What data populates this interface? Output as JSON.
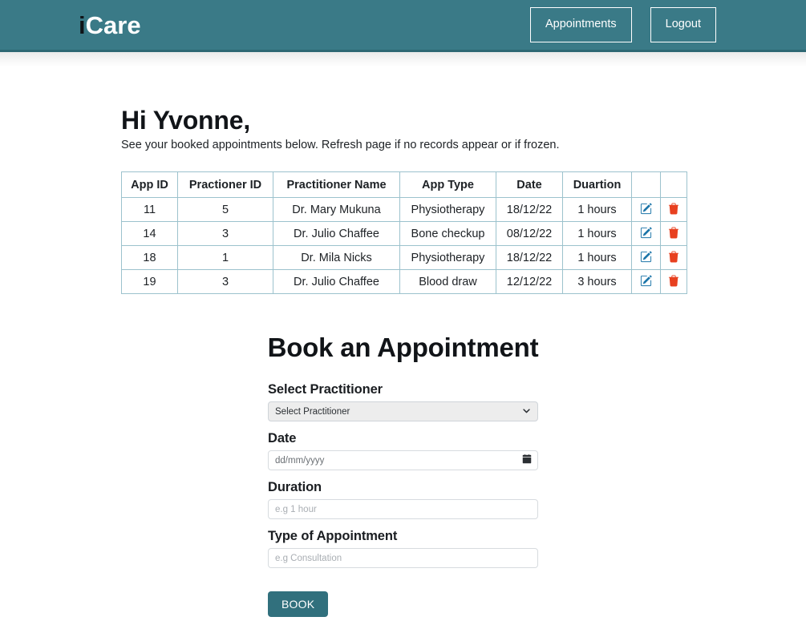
{
  "navbar": {
    "brand_i": "i",
    "brand_rest": "Care",
    "brand_color_dark": "#101418",
    "brand_color_light": "#ffffff",
    "background_color": "#3a7a87",
    "buttons": [
      {
        "label": "Appointments",
        "name": "appointments-button"
      },
      {
        "label": "Logout",
        "name": "logout-button"
      }
    ]
  },
  "greeting": {
    "title": "Hi Yvonne,",
    "subtitle": "See your booked appointments below. Refresh page if no records appear or if frozen."
  },
  "appointments_table": {
    "border_color": "#9cc2cd",
    "edit_icon_color": "#1b74a8",
    "delete_icon_color": "#e8401f",
    "columns": [
      "App ID",
      "Practioner ID",
      "Practitioner Name",
      "App Type",
      "Date",
      "Duartion",
      "",
      ""
    ],
    "rows": [
      {
        "app_id": "11",
        "practitioner_id": "5",
        "practitioner_name": "Dr. Mary Mukuna",
        "app_type": "Physiotherapy",
        "date": "18/12/22",
        "duration": "1 hours"
      },
      {
        "app_id": "14",
        "practitioner_id": "3",
        "practitioner_name": "Dr. Julio Chaffee",
        "app_type": "Bone checkup",
        "date": "08/12/22",
        "duration": "1 hours"
      },
      {
        "app_id": "18",
        "practitioner_id": "1",
        "practitioner_name": "Dr. Mila Nicks",
        "app_type": "Physiotherapy",
        "date": "18/12/22",
        "duration": "1 hours"
      },
      {
        "app_id": "19",
        "practitioner_id": "3",
        "practitioner_name": "Dr. Julio Chaffee",
        "app_type": "Blood draw",
        "date": "12/12/22",
        "duration": "3 hours"
      }
    ]
  },
  "booking_form": {
    "title": "Book an Appointment",
    "practitioner": {
      "label": "Select Practitioner",
      "selected_option": "Select Practitioner"
    },
    "date": {
      "label": "Date",
      "placeholder": "dd/mm/yyyy",
      "value": ""
    },
    "duration": {
      "label": "Duration",
      "placeholder": "e.g 1 hour",
      "value": ""
    },
    "appointment_type": {
      "label": "Type of Appointment",
      "placeholder": "e.g Consultation",
      "value": ""
    },
    "submit": {
      "label": "BOOK",
      "background_color": "#31707d"
    }
  }
}
